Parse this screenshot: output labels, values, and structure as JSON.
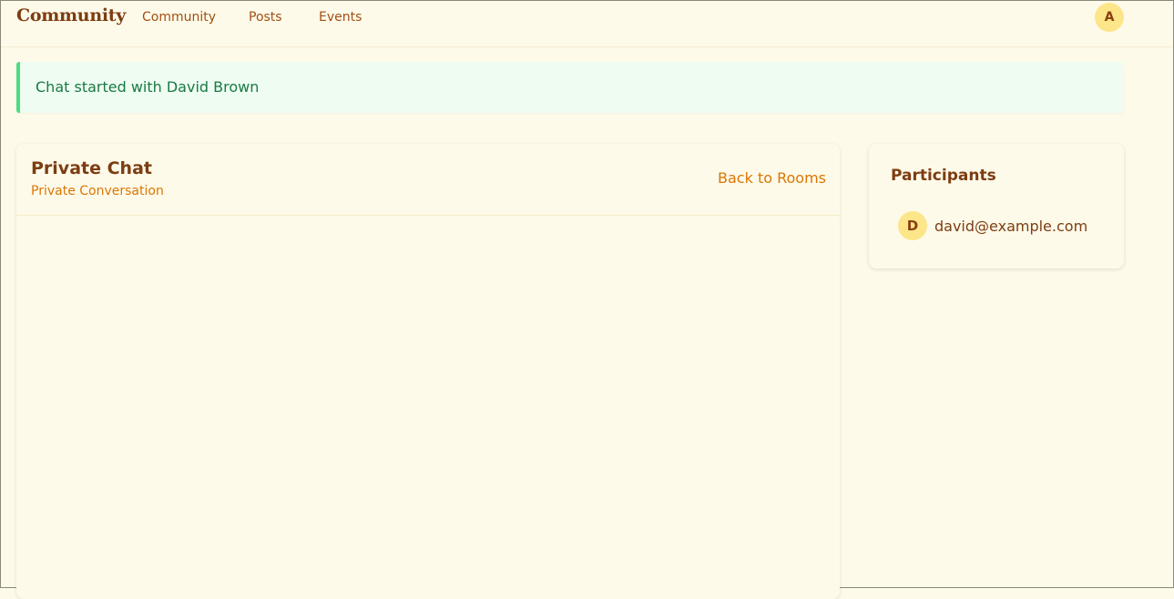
{
  "nav": {
    "brand": "Community",
    "links": [
      "Community",
      "Posts",
      "Events"
    ],
    "user_initial": "A"
  },
  "alert": {
    "message": "Chat started with David Brown"
  },
  "chat": {
    "title": "Private Chat",
    "subtitle": "Private Conversation",
    "back_label": "Back to Rooms"
  },
  "participants": {
    "title": "Participants",
    "items": [
      {
        "initial": "D",
        "email": "david@example.com"
      }
    ]
  },
  "colors": {
    "background": "#fefae9",
    "brand": "#7c3d12",
    "accent": "#d97706",
    "avatar_bg": "#fde58a",
    "success_bg": "#effcf2",
    "success_border": "#4ade80",
    "success_text": "#197a43"
  }
}
